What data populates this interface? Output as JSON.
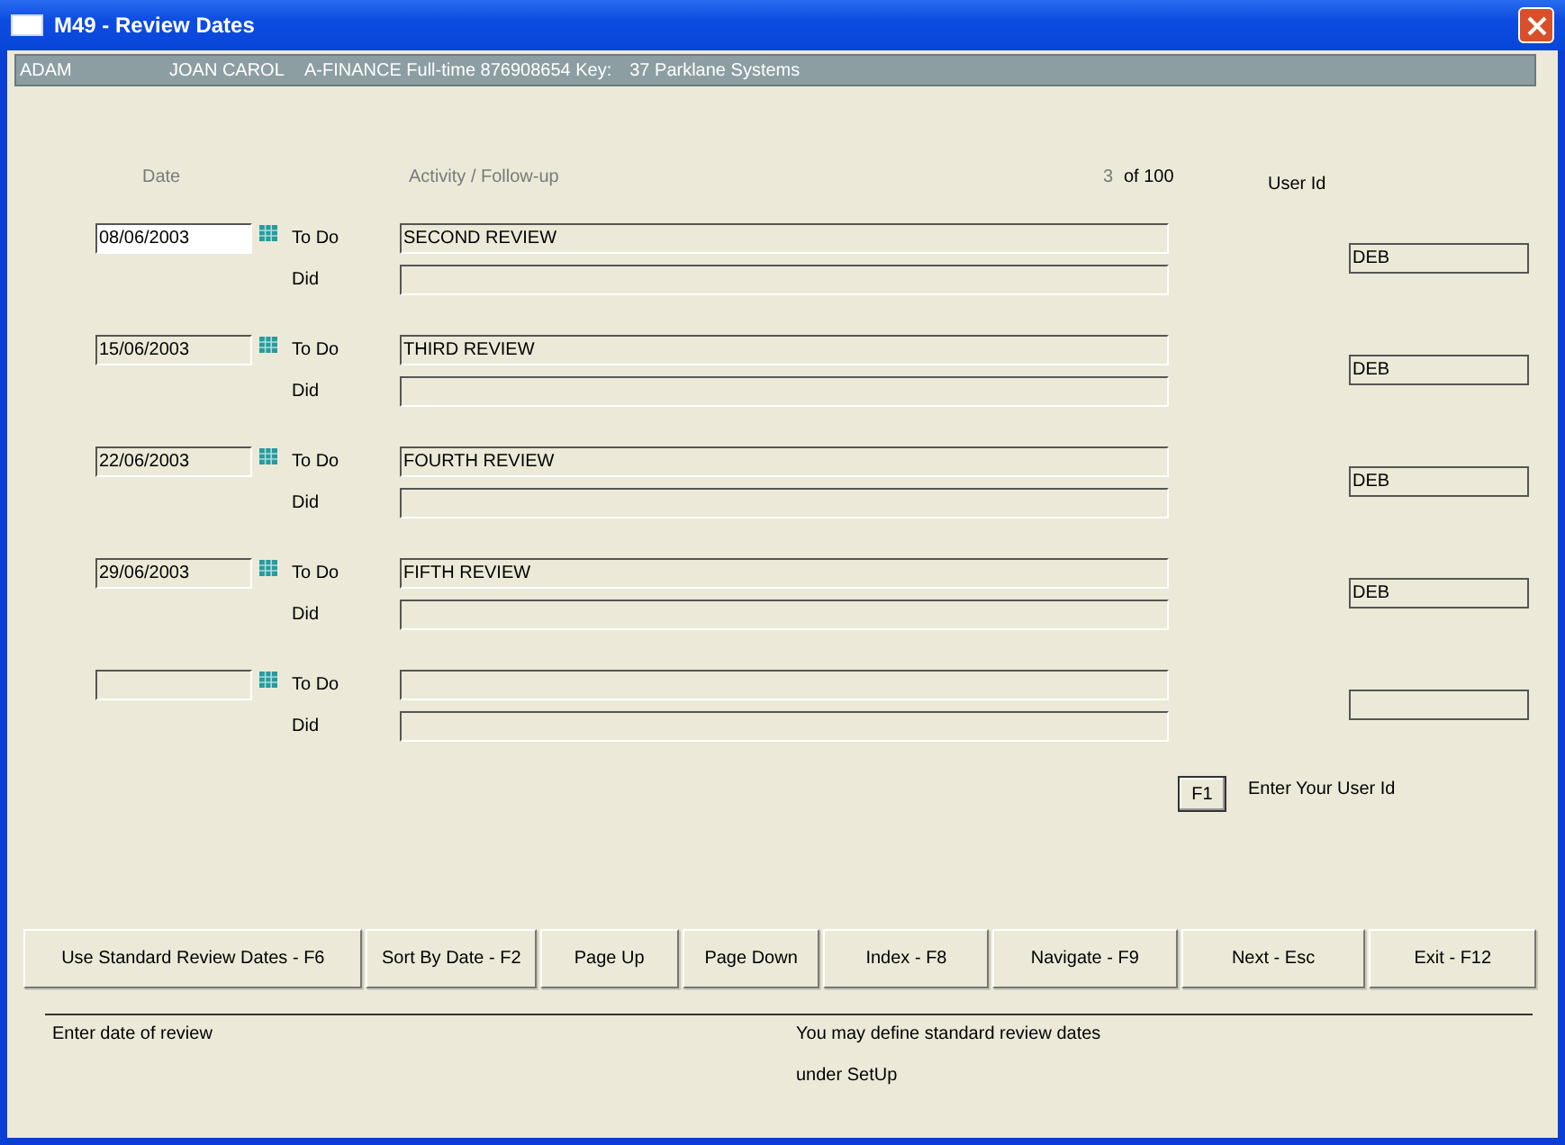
{
  "window": {
    "title": "M49 - Review Dates"
  },
  "info_bar": [
    "ADAM",
    "JOAN CAROL",
    "A-FINANCE  Full-time 876908654 Key:",
    "37 Parklane Systems"
  ],
  "headers": {
    "date": "Date",
    "activity": "Activity / Follow-up",
    "user_id": "User Id"
  },
  "record_counter": {
    "current": "3",
    "total": "of 100"
  },
  "entries": [
    {
      "date": "08/06/2003",
      "focused": true,
      "todo_label": "To Do",
      "todo": "SECOND REVIEW",
      "did_label": "Did",
      "user_id": "DEB"
    },
    {
      "date": "15/06/2003",
      "focused": false,
      "todo_label": "To Do",
      "todo": "THIRD REVIEW",
      "did_label": "Did",
      "user_id": "DEB"
    },
    {
      "date": "22/06/2003",
      "focused": false,
      "todo_label": "To Do",
      "todo": "FOURTH REVIEW",
      "did_label": "Did",
      "user_id": "DEB"
    },
    {
      "date": "29/06/2003",
      "focused": false,
      "todo_label": "To Do",
      "todo": "FIFTH REVIEW",
      "did_label": "Did",
      "user_id": "DEB"
    },
    {
      "focused": false,
      "todo_label": "To Do",
      "did_label": "Did"
    }
  ],
  "user_id_hint": {
    "key": "F1",
    "text": "Enter Your User Id"
  },
  "buttons": [
    "Use Standard Review Dates - F6",
    "Sort By Date - F2",
    "Page Up",
    "Page Down",
    "Index - F8",
    "Navigate - F9",
    "Next - Esc",
    "Exit - F12"
  ],
  "status": {
    "left": "Enter date of review",
    "right_lines": [
      "You may define standard review dates",
      "under SetUp"
    ]
  }
}
